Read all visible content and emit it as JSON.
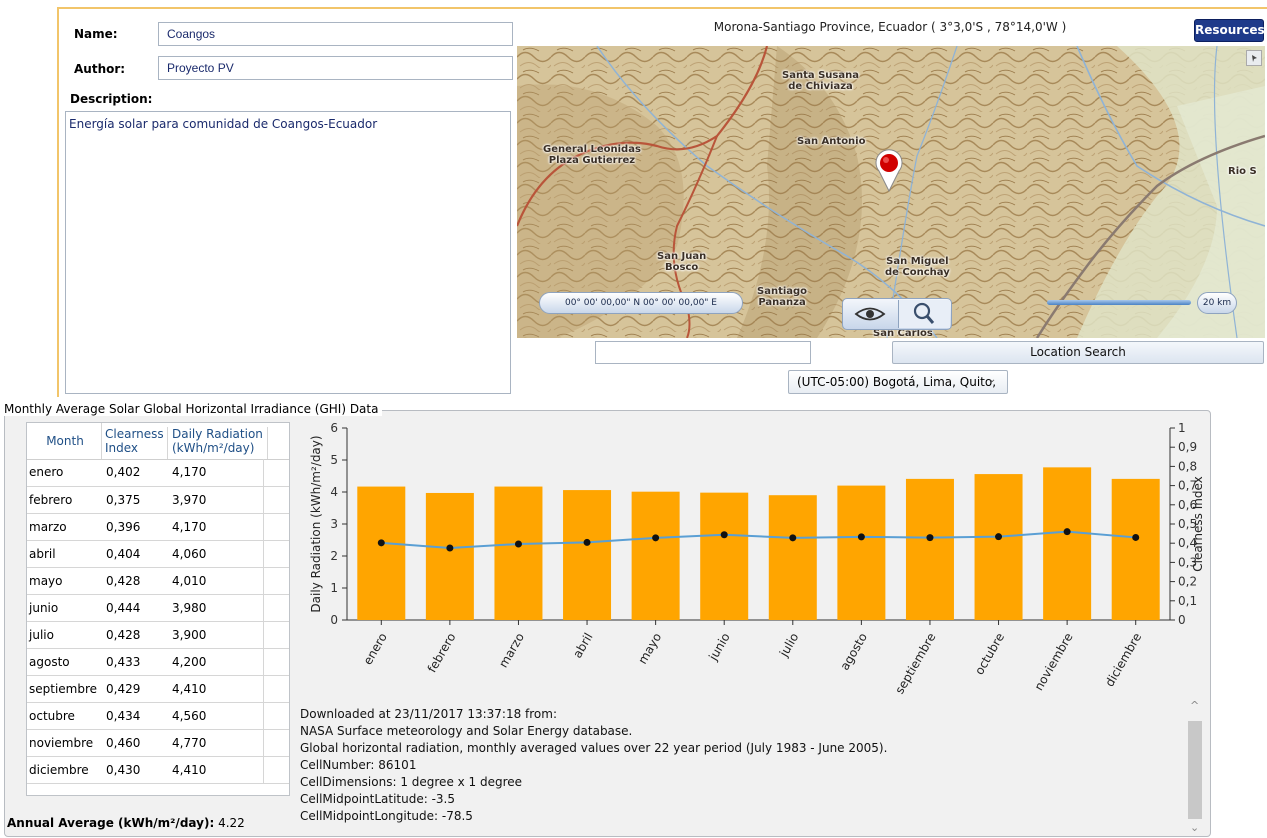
{
  "form": {
    "name_label": "Name:",
    "name_value": "Coangos",
    "author_label": "Author:",
    "author_value": "Proyecto PV",
    "description_label": "Description:",
    "description_value": "Energía solar para comunidad de Coangos-Ecuador"
  },
  "map": {
    "location_title": "Morona-Santiago Province, Ecuador ( 3°3,0'S , 78°14,0'W )",
    "resources_button": "Resources",
    "coordinates": "00° 00' 00,00\" N 00° 00' 00,00\" E",
    "scale_label": "20 km",
    "places": {
      "santa_susana": "Santa Susana\nde Chiviaza",
      "san_antonio": "San Antonio",
      "general": "General Leonidas\nPlaza Gutierrez",
      "rio": "Rio S",
      "san_juan": "San Juan\nBosco",
      "san_miguel": "San Miguel\nde Conchay",
      "santiago": "Santiago\nPananza",
      "san_carlos": "San Carlos"
    },
    "search_value": "",
    "location_search_button": "Location Search",
    "timezone": "(UTC-05:00) Bogotá, Lima, Quito,"
  },
  "ghi": {
    "group_title": "Monthly Average Solar Global Horizontal Irradiance (GHI) Data",
    "table_headers": [
      "Month",
      "Clearness\nIndex",
      "Daily Radiation\n(kWh/m²/day)"
    ],
    "rows": [
      [
        "enero",
        "0,402",
        "4,170"
      ],
      [
        "febrero",
        "0,375",
        "3,970"
      ],
      [
        "marzo",
        "0,396",
        "4,170"
      ],
      [
        "abril",
        "0,404",
        "4,060"
      ],
      [
        "mayo",
        "0,428",
        "4,010"
      ],
      [
        "junio",
        "0,444",
        "3,980"
      ],
      [
        "julio",
        "0,428",
        "3,900"
      ],
      [
        "agosto",
        "0,433",
        "4,200"
      ],
      [
        "septiembre",
        "0,429",
        "4,410"
      ],
      [
        "octubre",
        "0,434",
        "4,560"
      ],
      [
        "noviembre",
        "0,460",
        "4,770"
      ],
      [
        "diciembre",
        "0,430",
        "4,410"
      ]
    ],
    "annual_label": "Annual Average (kWh/m²/day):",
    "annual_value": "4.22",
    "log_lines": [
      "Downloaded at 23/11/2017 13:37:18 from:",
      "NASA Surface meteorology and Solar Energy database.",
      "Global horizontal radiation, monthly averaged values over 22 year period (July 1983 - June 2005).",
      "CellNumber: 86101",
      "CellDimensions: 1 degree x 1 degree",
      "CellMidpointLatitude: -3.5",
      "CellMidpointLongitude: -78.5"
    ]
  },
  "chart_data": {
    "type": "bar",
    "categories": [
      "enero",
      "febrero",
      "marzo",
      "abril",
      "mayo",
      "junio",
      "julio",
      "agosto",
      "septiembre",
      "octubre",
      "noviembre",
      "diciembre"
    ],
    "series": [
      {
        "values": [
          4.17,
          3.97,
          4.17,
          4.06,
          4.01,
          3.98,
          3.9,
          4.2,
          4.41,
          4.56,
          4.77,
          4.41
        ],
        "axis": "left",
        "render": "bar",
        "color": "#ffa500"
      },
      {
        "values": [
          0.402,
          0.375,
          0.396,
          0.404,
          0.428,
          0.444,
          0.428,
          0.433,
          0.429,
          0.434,
          0.46,
          0.43
        ],
        "axis": "right",
        "render": "line",
        "color": "#5a9fd4"
      }
    ],
    "ylabel": "Daily Radiation (kWh/m²/day)",
    "ylabel_right": "Clearness Index",
    "ylim": [
      0,
      6
    ],
    "ylim_right": [
      0,
      1
    ],
    "yticks": [
      "0",
      "1",
      "2",
      "3",
      "4",
      "5",
      "6"
    ],
    "yticks_right": [
      "0",
      "0,1",
      "0,2",
      "0,3",
      "0,4",
      "0,5",
      "0,6",
      "0,7",
      "0,8",
      "0,9",
      "1"
    ],
    "grid": false,
    "legend": "none"
  }
}
